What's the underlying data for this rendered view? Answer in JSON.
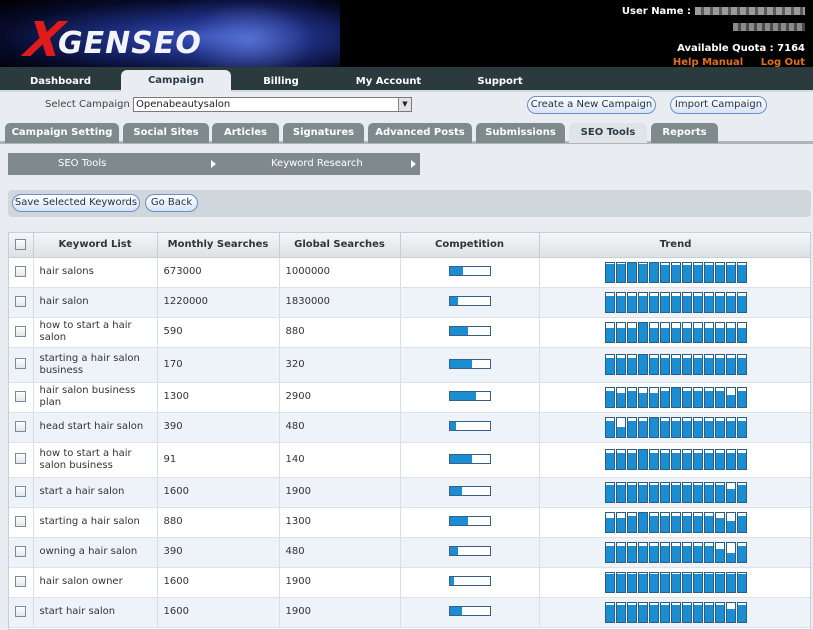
{
  "header": {
    "logo_x": "X",
    "logo_text": "GENSEO",
    "user_label": "User Name :",
    "quota_label": "Available Quota : 7164",
    "help_link": "Help Manual",
    "logout_link": "Log Out"
  },
  "mainnav": [
    "Dashboard",
    "Campaign",
    "Billing",
    "My Account",
    "Support"
  ],
  "campaign": {
    "select_label": "Select Campaign :",
    "selected": "Openabeautysalon",
    "create_button": "Create a New Campaign",
    "import_button": "Import Campaign"
  },
  "subtabs": [
    "Campaign Setting",
    "Social Sites",
    "Articles",
    "Signatures",
    "Advanced Posts",
    "Submissions",
    "SEO Tools",
    "Reports"
  ],
  "breadcrumb": [
    "SEO Tools",
    "Keyword Research"
  ],
  "actions": {
    "save_button": "Save Selected Keywords",
    "back_button": "Go Back"
  },
  "table": {
    "headers": [
      "Keyword List",
      "Monthly Searches",
      "Global Searches",
      "Competition",
      "Trend"
    ],
    "rows": [
      {
        "keyword": "hair salons",
        "monthly": "673000",
        "global": "1000000",
        "competition": 0.33,
        "trend": [
          0.95,
          0.95,
          1.0,
          0.95,
          1.0,
          0.9,
          0.9,
          0.9,
          0.9,
          0.9,
          0.9,
          0.9,
          0.9
        ]
      },
      {
        "keyword": "hair salon",
        "monthly": "1220000",
        "global": "1830000",
        "competition": 0.2,
        "trend": [
          0.85,
          0.85,
          0.85,
          0.85,
          0.85,
          0.85,
          0.85,
          0.85,
          0.85,
          0.85,
          0.85,
          0.85,
          0.85
        ]
      },
      {
        "keyword": "how to start a hair salon",
        "monthly": "590",
        "global": "880",
        "competition": 0.45,
        "trend": [
          0.75,
          0.75,
          0.75,
          1.0,
          0.75,
          0.75,
          0.75,
          0.75,
          0.75,
          0.75,
          0.75,
          0.75,
          0.75
        ]
      },
      {
        "keyword": "starting a hair salon business",
        "monthly": "170",
        "global": "320",
        "competition": 0.55,
        "trend": [
          0.85,
          0.85,
          0.85,
          1.0,
          0.85,
          0.85,
          0.85,
          0.85,
          0.85,
          0.85,
          0.85,
          0.85,
          0.85
        ]
      },
      {
        "keyword": "hair salon business plan",
        "monthly": "1300",
        "global": "2900",
        "competition": 0.65,
        "trend": [
          0.85,
          0.75,
          0.85,
          0.75,
          0.75,
          0.85,
          1.0,
          0.85,
          0.85,
          0.85,
          0.85,
          0.65,
          0.85
        ]
      },
      {
        "keyword": "head start hair salon",
        "monthly": "390",
        "global": "480",
        "competition": 0.15,
        "trend": [
          0.85,
          0.55,
          0.85,
          0.85,
          1.0,
          0.85,
          0.85,
          0.85,
          0.85,
          0.85,
          0.85,
          0.85,
          0.85
        ]
      },
      {
        "keyword": "how to start a hair salon business",
        "monthly": "91",
        "global": "140",
        "competition": 0.55,
        "trend": [
          0.85,
          0.85,
          0.85,
          1.0,
          0.85,
          0.85,
          0.85,
          0.85,
          0.85,
          0.85,
          0.85,
          0.85,
          0.85
        ]
      },
      {
        "keyword": "start a hair salon",
        "monthly": "1600",
        "global": "1900",
        "competition": 0.3,
        "trend": [
          0.9,
          0.9,
          0.9,
          0.9,
          0.9,
          0.9,
          0.9,
          0.9,
          0.9,
          0.9,
          0.9,
          0.7,
          0.9
        ]
      },
      {
        "keyword": "starting a hair salon",
        "monthly": "880",
        "global": "1300",
        "competition": 0.45,
        "trend": [
          0.75,
          0.75,
          0.85,
          1.0,
          0.85,
          0.85,
          0.85,
          0.85,
          0.85,
          0.85,
          0.75,
          0.6,
          0.85
        ]
      },
      {
        "keyword": "owning a hair salon",
        "monthly": "390",
        "global": "480",
        "competition": 0.2,
        "trend": [
          0.85,
          0.85,
          0.85,
          0.85,
          0.85,
          0.85,
          0.85,
          0.85,
          0.85,
          0.85,
          0.7,
          0.45,
          0.85
        ]
      },
      {
        "keyword": "hair salon owner",
        "monthly": "1600",
        "global": "1900",
        "competition": 0.1,
        "trend": [
          0.95,
          0.95,
          0.95,
          0.95,
          0.95,
          0.95,
          0.95,
          0.95,
          0.95,
          0.95,
          0.95,
          0.95,
          0.95
        ]
      },
      {
        "keyword": "start hair salon",
        "monthly": "1600",
        "global": "1900",
        "competition": 0.3,
        "trend": [
          0.9,
          0.9,
          0.9,
          0.9,
          0.9,
          0.9,
          0.9,
          0.9,
          0.9,
          0.9,
          0.9,
          0.7,
          0.9
        ]
      }
    ]
  }
}
